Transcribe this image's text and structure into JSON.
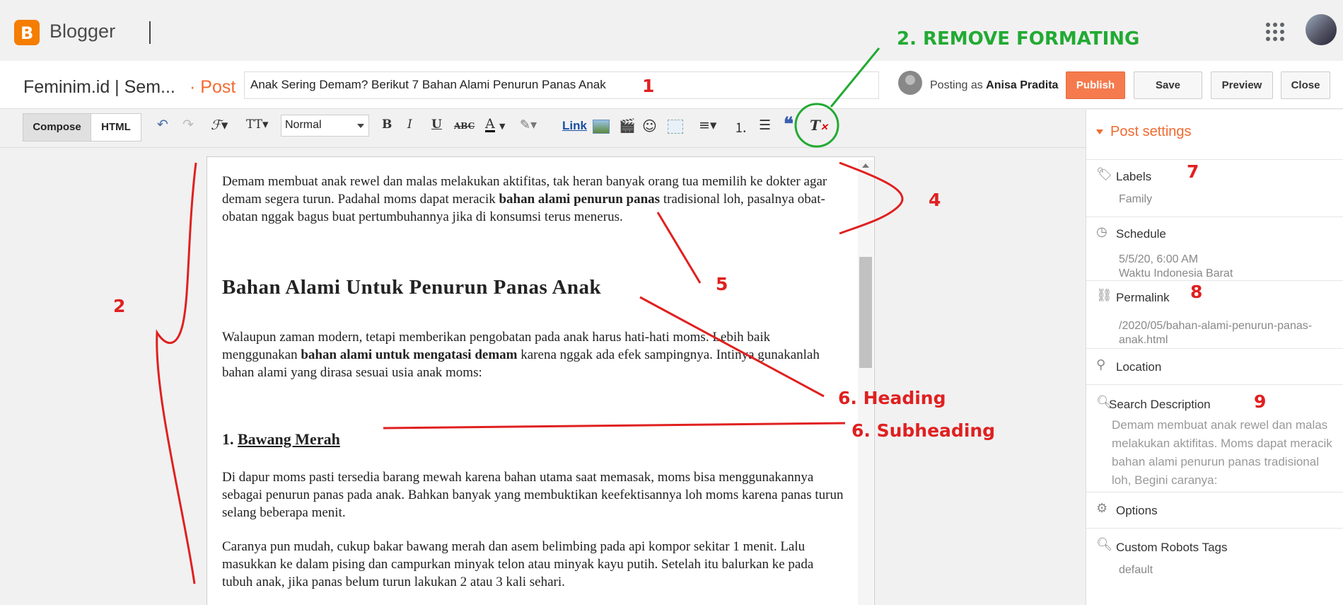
{
  "app": {
    "name": "Blogger"
  },
  "title_bar": {
    "blog_name": "Feminim.id | Sem...",
    "post_type": "· Post",
    "post_title": "Anak Sering Demam? Berikut 7 Bahan Alami Penurun Panas Anak",
    "posting_as_prefix": "Posting as",
    "author": "Anisa Pradita",
    "buttons": {
      "publish": "Publish",
      "save": "Save",
      "preview": "Preview",
      "close": "Close"
    }
  },
  "toolbar": {
    "compose": "Compose",
    "html": "HTML",
    "format_value": "Normal",
    "link": "Link"
  },
  "editor": {
    "p1": "Demam membuat anak rewel dan malas melakukan aktifitas, tak heran banyak orang tua memilih ke dokter agar demam segera turun. Padahal moms dapat meracik ",
    "p1_bold": "bahan alami penurun panas",
    "p1_end": " tradisional loh, pasalnya obat-obatan nggak bagus buat pertumbuhannya jika di konsumsi terus menerus.",
    "heading": "Bahan Alami Untuk Penurun Panas Anak",
    "p2": "Walaupun zaman modern, tetapi memberikan pengobatan pada anak harus hati-hati moms. Lebih baik menggunakan ",
    "p2_bold": "bahan alami untuk mengatasi demam",
    "p2_end": " karena nggak ada efek sampingnya. Intinya gunakanlah bahan alami yang dirasa sesuai usia anak moms:",
    "subheading_num": "1. ",
    "subheading": "Bawang Merah",
    "p3": "Di dapur moms pasti tersedia barang mewah karena bahan utama saat memasak, moms bisa menggunakannya sebagai penurun panas pada anak. Bahkan banyak yang membuktikan keefektisannya loh moms karena panas turun selang beberapa menit.",
    "p4": "Caranya pun mudah, cukup bakar bawang merah dan asem belimbing pada api kompor sekitar 1 menit. Lalu masukkan ke dalam pising dan campurkan minyak telon atau minyak kayu putih. Setelah itu balurkan ke pada tubuh anak, jika panas belum turun lakukan 2 atau 3 kali sehari."
  },
  "post_settings": {
    "header": "Post settings",
    "labels": {
      "title": "Labels",
      "value": "Family"
    },
    "schedule": {
      "title": "Schedule",
      "value1": "5/5/20, 6:00 AM",
      "value2": "Waktu Indonesia Barat"
    },
    "permalink": {
      "title": "Permalink",
      "value": "/2020/05/bahan-alami-penurun-panas-anak.html"
    },
    "location": {
      "title": "Location"
    },
    "search_description": {
      "title": "Search Description",
      "value": "Demam membuat anak rewel dan malas melakukan aktifitas. Moms dapat meracik bahan alami penurun panas tradisional loh, Begini caranya:"
    },
    "options": {
      "title": "Options"
    },
    "robots": {
      "title": "Custom Robots Tags",
      "value": "default"
    }
  },
  "annotations": {
    "remove_formatting": "2. REMOVE FORMATING",
    "n1": "1",
    "n2": "2",
    "n4": "4",
    "n5": "5",
    "heading": "6. Heading",
    "subheading": "6. Subheading",
    "n7": "7",
    "n8": "8",
    "n9": "9",
    "red": "#e02020",
    "green": "#22aa33"
  },
  "colors": {
    "accent": "#f26a30",
    "publish": "#f57b4e",
    "logo": "#f57d00"
  }
}
